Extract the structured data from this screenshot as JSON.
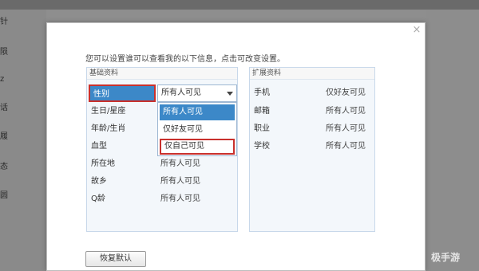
{
  "background_fragments": [
    "针",
    "陨",
    "z",
    "话",
    "履",
    "态",
    "圆"
  ],
  "dialog": {
    "close_glyph": "×",
    "hint": "您可以设置谁可以查看我的以下信息，点击可改变设置。",
    "basic": {
      "title": "基础资料",
      "gender_label": "性别",
      "gender_value": "所有人可见",
      "rows": [
        {
          "label": "生日/星座",
          "value": ""
        },
        {
          "label": "年龄/生肖",
          "value": ""
        },
        {
          "label": "血型",
          "value": ""
        },
        {
          "label": "所在地",
          "value": "所有人可见"
        },
        {
          "label": "故乡",
          "value": "所有人可见"
        },
        {
          "label": "Q龄",
          "value": "所有人可见"
        }
      ]
    },
    "dropdown_options": [
      "所有人可见",
      "仅好友可见",
      "仅自己可见"
    ],
    "extended": {
      "title": "扩展资料",
      "rows": [
        {
          "label": "手机",
          "value": "仅好友可见"
        },
        {
          "label": "邮箱",
          "value": "所有人可见"
        },
        {
          "label": "职业",
          "value": "所有人可见"
        },
        {
          "label": "学校",
          "value": "所有人可见"
        }
      ]
    },
    "restore_button": "恢复默认"
  },
  "watermark": "极手游",
  "colors": {
    "accent": "#3c88c8",
    "highlight_border": "#c9302c",
    "panel_bg": "#f3f7fb"
  }
}
